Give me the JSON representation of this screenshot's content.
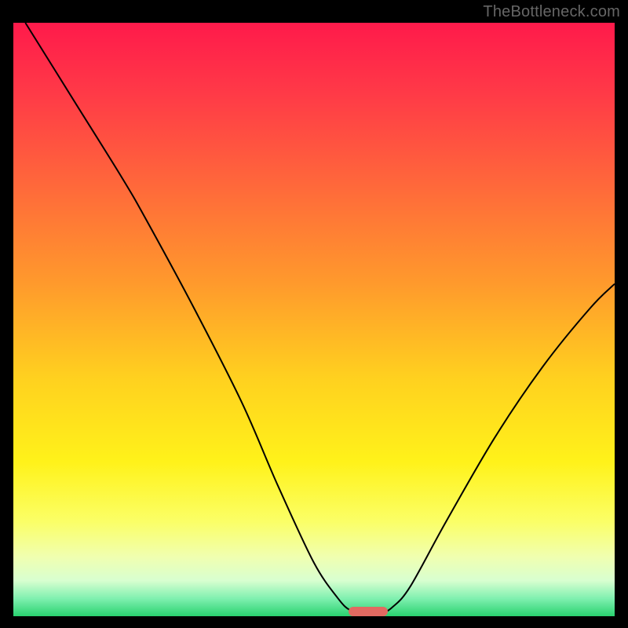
{
  "attribution": "TheBottleneck.com",
  "colors": {
    "frame": "#000000",
    "gradient_stops": [
      {
        "offset": 0.0,
        "color": "#ff1a4b"
      },
      {
        "offset": 0.12,
        "color": "#ff3a47"
      },
      {
        "offset": 0.28,
        "color": "#ff6a3a"
      },
      {
        "offset": 0.44,
        "color": "#ff9a2c"
      },
      {
        "offset": 0.6,
        "color": "#ffd11f"
      },
      {
        "offset": 0.74,
        "color": "#fff21a"
      },
      {
        "offset": 0.84,
        "color": "#fbff66"
      },
      {
        "offset": 0.9,
        "color": "#f0ffb0"
      },
      {
        "offset": 0.94,
        "color": "#d8ffd0"
      },
      {
        "offset": 0.97,
        "color": "#80f0b0"
      },
      {
        "offset": 1.0,
        "color": "#29d26f"
      }
    ],
    "curve_stroke": "#000000",
    "marker_fill": "#e26a61"
  },
  "chart_data": {
    "type": "line",
    "title": "",
    "xlabel": "",
    "ylabel": "",
    "xlim": [
      0,
      100
    ],
    "ylim": [
      0,
      100
    ],
    "grid": false,
    "series": [
      {
        "name": "bottleneck-curve",
        "points": [
          {
            "x": 2,
            "y": 100
          },
          {
            "x": 10,
            "y": 87
          },
          {
            "x": 18,
            "y": 74
          },
          {
            "x": 22,
            "y": 67
          },
          {
            "x": 30,
            "y": 52
          },
          {
            "x": 38,
            "y": 36
          },
          {
            "x": 44,
            "y": 22
          },
          {
            "x": 50,
            "y": 9
          },
          {
            "x": 54,
            "y": 3
          },
          {
            "x": 56,
            "y": 1
          },
          {
            "x": 58,
            "y": 0.5
          },
          {
            "x": 61,
            "y": 0.5
          },
          {
            "x": 63,
            "y": 1.5
          },
          {
            "x": 66,
            "y": 5
          },
          {
            "x": 72,
            "y": 16
          },
          {
            "x": 80,
            "y": 30
          },
          {
            "x": 88,
            "y": 42
          },
          {
            "x": 96,
            "y": 52
          },
          {
            "x": 100,
            "y": 56
          }
        ]
      }
    ],
    "marker": {
      "x_center": 59,
      "width_pct": 6.5,
      "height_pct": 1.6,
      "y": 0
    }
  }
}
